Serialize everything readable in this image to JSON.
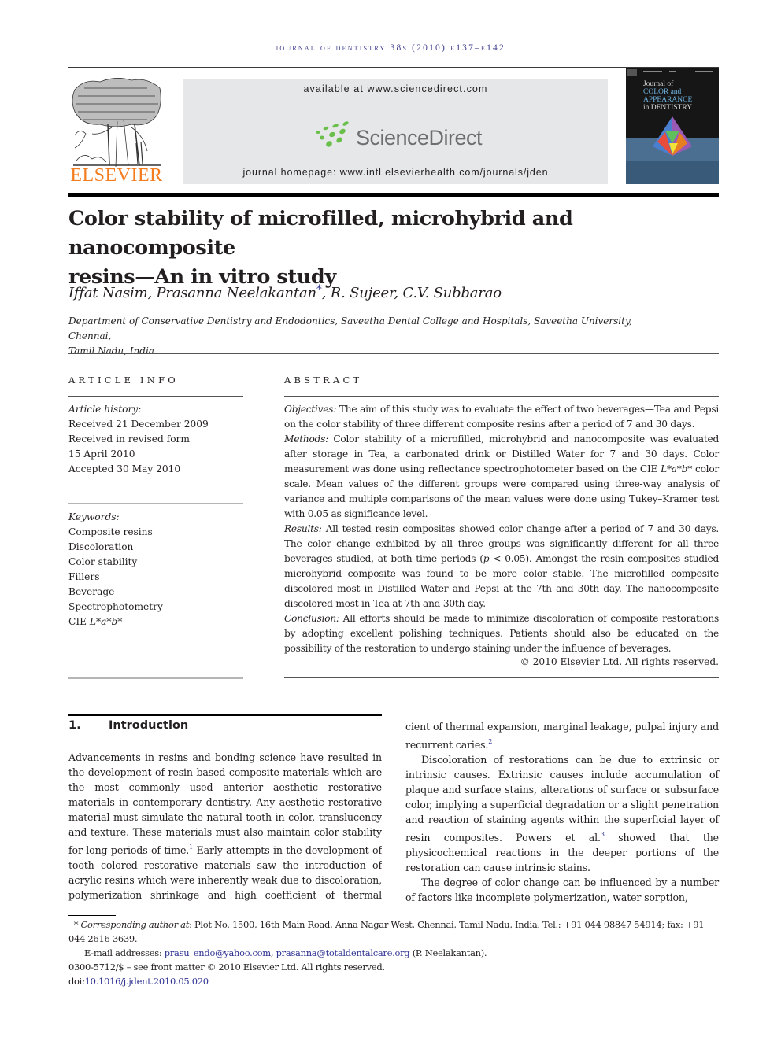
{
  "running_head": "journal of dentistry 38s (2010) e137–e142",
  "publisher": {
    "logo_icon": "elsevier-tree-icon",
    "name": "ELSEVIER",
    "brand_color": "#f47d20"
  },
  "sciencedirect": {
    "available_text": "available at www.sciencedirect.com",
    "logo_icon": "sciencedirect-dots-icon",
    "logo_text": "ScienceDirect",
    "homepage_text": "journal homepage: www.intl.elsevierhealth.com/journals/jden",
    "dot_color": "#6abf4b",
    "box_color": "#e6e7e8"
  },
  "cover": {
    "title_lines": [
      "Journal of",
      "COLOR and",
      "APPEARANCE",
      "in DENTISTRY"
    ]
  },
  "article": {
    "title_line1": "Color stability of microfilled, microhybrid and nanocomposite",
    "title_line2": "resins—An in vitro study",
    "authors_before_star": "Iffat Nasim, Prasanna Neelakantan",
    "star": "*",
    "authors_after_star": ", R. Sujeer, C.V. Subbarao",
    "affiliation_line1": "Department of Conservative Dentistry and Endodontics, Saveetha Dental College and Hospitals, Saveetha University, Chennai,",
    "affiliation_line2": "Tamil Nadu, India"
  },
  "article_info": {
    "heading": "ARTICLE INFO",
    "history_label": "Article history:",
    "history": [
      "Received 21 December 2009",
      "Received in revised form",
      "15 April 2010",
      "Accepted 30 May 2010"
    ],
    "keywords_label": "Keywords:",
    "keywords": [
      "Composite resins",
      "Discoloration",
      "Color stability",
      "Fillers",
      "Beverage",
      "Spectrophotometry"
    ],
    "keyword_cie_prefix": "CIE ",
    "keyword_cie_italic": "L*a*b*"
  },
  "abstract": {
    "heading": "ABSTRACT",
    "objectives_label": "Objectives:",
    "objectives_text": " The aim of this study was to evaluate the effect of two beverages—Tea and Pepsi on the color stability of three different composite resins after a period of 7 and 30 days.",
    "methods_label": "Methods:",
    "methods_text_1": " Color stability of a microfilled, microhybrid and nanocomposite was evaluated after storage in Tea, a carbonated drink or Distilled Water for 7 and 30 days. Color measurement was done using reflectance spectrophotometer based on the CIE ",
    "methods_italic": "L*a*b*",
    "methods_text_2": " color scale. Mean values of the different groups were compared using three-way analysis of variance and multiple comparisons of the mean values were done using Tukey–Kramer test with 0.05 as significance level.",
    "results_label": "Results:",
    "results_text_1": " All tested resin composites showed color change after a period of 7 and 30 days. The color change exhibited by all three groups was significantly different for all three beverages studied, at both time periods (",
    "results_p": "p",
    "results_text_2": " < 0.05). Amongst the resin composites studied microhybrid composite was found to be more color stable. The microfilled composite discolored most in Distilled Water and Pepsi at the 7th and 30th day. The nanocomposite discolored most in Tea at 7th and 30th day.",
    "conclusion_label": "Conclusion:",
    "conclusion_text": " All efforts should be made to minimize discoloration of composite restorations by adopting excellent polishing techniques. Patients should also be educated on the possibility of the restoration to undergo staining under the influence of beverages.",
    "copyright": "© 2010 Elsevier Ltd. All rights reserved."
  },
  "introduction": {
    "number": "1.",
    "heading": "Introduction",
    "p1_a": "Advancements in resins and bonding science have resulted in the development of resin based composite materials which are the most commonly used anterior aesthetic restorative materials in contemporary dentistry. Any aesthetic restorative material must simulate the natural tooth in color, translucency and texture. These materials must also maintain color stability for long periods of time.",
    "ref1": "1",
    "p1_b": " Early attempts in the development of tooth colored restorative materials saw the introduction of acrylic resins which were inherently weak due to discoloration, polymerization shrinkage and high coefficient of thermal expansion, marginal leakage, pulpal injury and recurrent caries.",
    "ref2": "2",
    "p2_a": "Discoloration of restorations can be due to extrinsic or intrinsic causes. Extrinsic causes include accumulation of plaque and surface stains, alterations of surface or subsurface color, implying a superficial degradation or a slight penetration and reaction of staining agents within the superficial layer of resin composites. Powers et al.",
    "ref3": "3",
    "p2_b": " showed that the physicochemical reactions in the deeper portions of the restoration can cause intrinsic stains.",
    "p3": "The degree of color change can be influenced by a number of factors like incomplete polymerization, water sorption,"
  },
  "footnotes": {
    "star": "*",
    "corresponding_label": "Corresponding author at",
    "corresponding_text": ": Plot No. 1500, 16th Main Road, Anna Nagar West, Chennai, Tamil Nadu, India. Tel.: +91 044 98847 54914; fax: +91 044 2616 3639.",
    "email_label": "E-mail addresses: ",
    "email1": "prasu_endo@yahoo.com",
    "email_sep": ", ",
    "email2": "prasanna@totaldentalcare.org",
    "email_owner": " (P. Neelakantan).",
    "front_matter": "0300-5712/$ – see front matter © 2010 Elsevier Ltd. All rights reserved.",
    "doi_label": "doi:",
    "doi": "10.1016/j.jdent.2010.05.020"
  }
}
